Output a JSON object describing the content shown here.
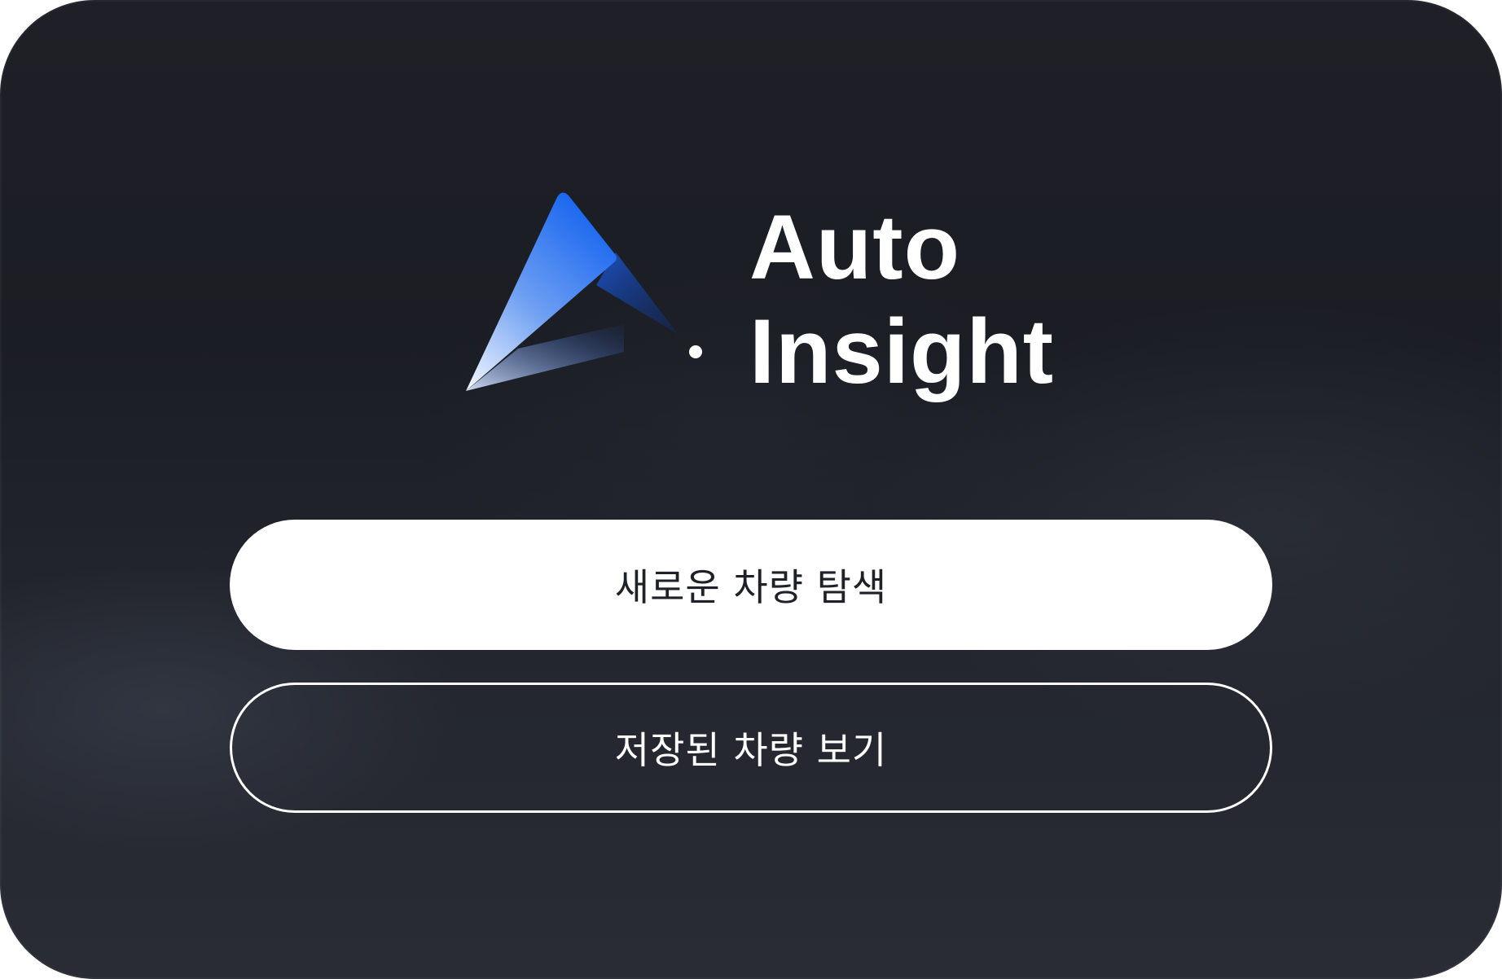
{
  "app": {
    "name_line1": "Auto",
    "name_line2": "Insight",
    "logo_icon": "auto-insight-triangle-logo"
  },
  "actions": {
    "primary_label": "새로운 차량 탐색",
    "secondary_label": "저장된 차량 보기"
  },
  "colors": {
    "background": "#1c1e25",
    "accent_blue": "#1463f0",
    "button_primary_bg": "#ffffff",
    "button_primary_text": "#1f2128",
    "button_secondary_border": "#ffffff"
  }
}
